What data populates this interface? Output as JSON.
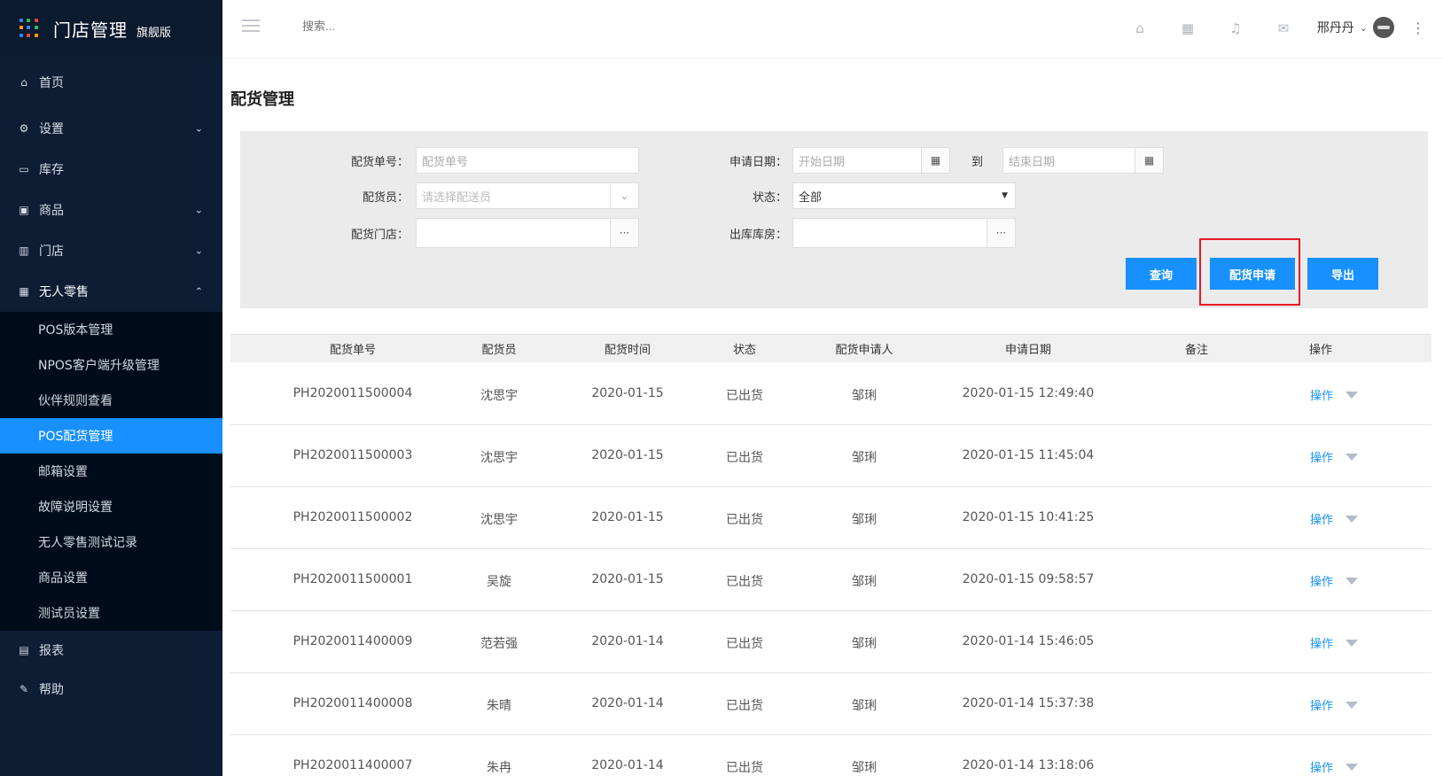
{
  "brand": {
    "title": "门店管理",
    "badge": "旗舰版",
    "grid_colors": [
      "#3b82f6",
      "#22c55e",
      "#ef4444",
      "#f59e0b",
      "#3b82f6",
      "#22c55e",
      "#3b82f6",
      "#ef4444",
      "#f59e0b"
    ]
  },
  "sidebar": {
    "items": [
      {
        "label": "首页",
        "icon": "home-icon",
        "chevron": ""
      },
      {
        "label": "设置",
        "icon": "settings-icon",
        "chevron": "⌄"
      },
      {
        "label": "库存",
        "icon": "inventory-icon",
        "chevron": ""
      },
      {
        "label": "商品",
        "icon": "gift-icon",
        "chevron": "⌄"
      },
      {
        "label": "门店",
        "icon": "store-icon",
        "chevron": "⌄"
      },
      {
        "label": "无人零售",
        "icon": "shop-icon",
        "chevron": "⌃"
      }
    ],
    "submenu": [
      {
        "label": "POS版本管理"
      },
      {
        "label": "NPOS客户端升级管理"
      },
      {
        "label": "伙伴规则查看"
      },
      {
        "label": "POS配货管理",
        "active": true
      },
      {
        "label": "邮箱设置"
      },
      {
        "label": "故障说明设置"
      },
      {
        "label": "无人零售测试记录"
      },
      {
        "label": "商品设置"
      },
      {
        "label": "测试员设置"
      }
    ],
    "bottom_items": [
      {
        "label": "报表",
        "icon": "report-icon"
      },
      {
        "label": "帮助",
        "icon": "help-icon"
      }
    ]
  },
  "topbar": {
    "search_placeholder": "搜索...",
    "user_name": "邢丹丹",
    "icons": [
      "home-icon",
      "grid-icon",
      "bell-icon",
      "mail-icon"
    ]
  },
  "page": {
    "title": "配货管理"
  },
  "filters": {
    "order_no_label": "配货单号：",
    "order_no_placeholder": "配货单号",
    "apply_date_label": "申请日期：",
    "start_date_placeholder": "开始日期",
    "to_label": "到",
    "end_date_placeholder": "结束日期",
    "dispatcher_label": "配货员：",
    "dispatcher_placeholder": "请选择配送员",
    "status_label": "状态：",
    "status_value": "全部",
    "store_label": "配货门店：",
    "warehouse_label": "出库库房：",
    "query_button": "查询",
    "apply_button": "配货申请",
    "export_button": "导出"
  },
  "table": {
    "columns": [
      "配货单号",
      "配货员",
      "配货时间",
      "状态",
      "配货申请人",
      "申请日期",
      "备注",
      "操作"
    ],
    "rows": [
      {
        "no": "PH2020011500004",
        "dispatcher": "沈思宇",
        "time": "2020-01-15",
        "status": "已出货",
        "applicant": "邹琍",
        "apply_date": "2020-01-15 12:49:40",
        "remark": "",
        "op": "操作"
      },
      {
        "no": "PH2020011500003",
        "dispatcher": "沈思宇",
        "time": "2020-01-15",
        "status": "已出货",
        "applicant": "邹琍",
        "apply_date": "2020-01-15 11:45:04",
        "remark": "",
        "op": "操作"
      },
      {
        "no": "PH2020011500002",
        "dispatcher": "沈思宇",
        "time": "2020-01-15",
        "status": "已出货",
        "applicant": "邹琍",
        "apply_date": "2020-01-15 10:41:25",
        "remark": "",
        "op": "操作"
      },
      {
        "no": "PH2020011500001",
        "dispatcher": "吴旋",
        "time": "2020-01-15",
        "status": "已出货",
        "applicant": "邹琍",
        "apply_date": "2020-01-15 09:58:57",
        "remark": "",
        "op": "操作"
      },
      {
        "no": "PH2020011400009",
        "dispatcher": "范若强",
        "time": "2020-01-14",
        "status": "已出货",
        "applicant": "邹琍",
        "apply_date": "2020-01-14 15:46:05",
        "remark": "",
        "op": "操作"
      },
      {
        "no": "PH2020011400008",
        "dispatcher": "朱晴",
        "time": "2020-01-14",
        "status": "已出货",
        "applicant": "邹琍",
        "apply_date": "2020-01-14 15:37:38",
        "remark": "",
        "op": "操作"
      },
      {
        "no": "PH2020011400007",
        "dispatcher": "朱冉",
        "time": "2020-01-14",
        "status": "已出货",
        "applicant": "邹琍",
        "apply_date": "2020-01-14 13:18:06",
        "remark": "",
        "op": "操作"
      }
    ]
  },
  "colors": {
    "sidebar_bg": "#0e1d33",
    "submenu_bg": "#000c1a",
    "accent": "#1890ff",
    "highlight": "#e51c23"
  }
}
